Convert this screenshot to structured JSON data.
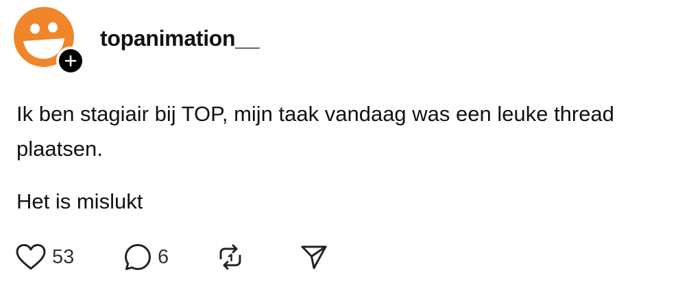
{
  "post": {
    "author": {
      "username": "topanimation__",
      "avatar_icon": "orange-smiley-face-icon",
      "avatar_color": "#F0852A",
      "follow_badge_icon": "plus-icon"
    },
    "paragraphs": [
      "Ik ben stagiair bij TOP, mijn taak vandaag was een leuke thread plaatsen.",
      "Het is mislukt"
    ],
    "actions": {
      "like": {
        "icon": "heart-icon",
        "count": "53"
      },
      "reply": {
        "icon": "comment-bubble-icon",
        "count": "6"
      },
      "repost": {
        "icon": "repost-icon"
      },
      "share": {
        "icon": "send-icon"
      }
    }
  }
}
